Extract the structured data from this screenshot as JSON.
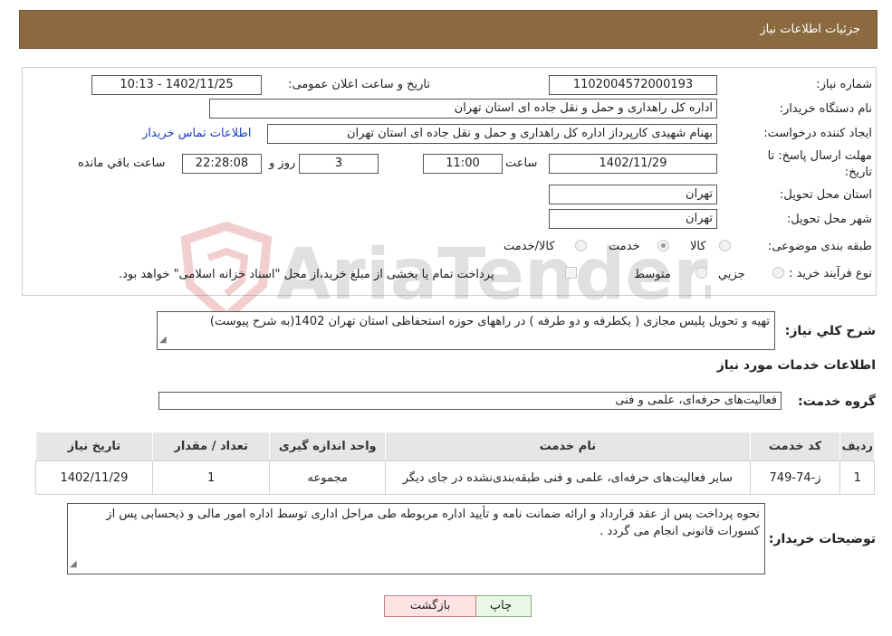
{
  "header": {
    "title": "جزئیات اطلاعات نیاز"
  },
  "form": {
    "need_number": {
      "label": "شماره نیاز:",
      "value": "1102004572000193"
    },
    "announce_datetime": {
      "label": "تاریخ و ساعت اعلان عمومی:",
      "value": "1402/11/25 - 10:13"
    },
    "buyer_org": {
      "label": "نام دستگاه خریدار:",
      "value": "اداره کل راهداری و حمل و نقل جاده ای استان تهران"
    },
    "requester": {
      "label": "ایجاد کننده درخواست:",
      "value": "بهنام شهیدی کارپرداز اداره کل راهداری و حمل و نقل جاده ای استان تهران",
      "contact_link": "اطلاعات تماس خریدار"
    },
    "deadline": {
      "label": "مهلت ارسال پاسخ: تا تاریخ:",
      "date": "1402/11/29",
      "time_label": "ساعت",
      "time": "11:00",
      "days": "3",
      "days_label": "روز و",
      "remaining": "22:28:08",
      "remaining_label": "ساعت باقي مانده"
    },
    "delivery_province": {
      "label": "استان محل تحویل:",
      "value": "تهران"
    },
    "delivery_city": {
      "label": "شهر محل تحویل:",
      "value": "تهران"
    },
    "category": {
      "label": "طبقه بندی موضوعی:",
      "options": [
        {
          "label": "کالا",
          "checked": false
        },
        {
          "label": "خدمت",
          "checked": true
        },
        {
          "label": "کالا/خدمت",
          "checked": false
        }
      ]
    },
    "purchase_process": {
      "label": "نوع فرآیند خرید :",
      "options": [
        {
          "label": "جزيي",
          "checked": false
        },
        {
          "label": "متوسط",
          "checked": false
        }
      ],
      "payment_note": "پرداخت تمام یا بخشی از مبلغ خرید،از محل \"اسناد خزانه اسلامی\" خواهد بود."
    }
  },
  "summary": {
    "label": "شرح کلي نياز:",
    "value": "تهیه و تحویل پلیس مجازی ( یکطرفه و دو طرفه ) در راههای حوزه استحفاظی استان تهران 1402(به شرح پیوست)"
  },
  "services_info": {
    "title": "اطلاعات خدمات مورد نياز",
    "group_label": "گروه خدمت:",
    "group_value": "فعالیت‌های حرفه‌ای، علمی و فنی"
  },
  "table": {
    "headers": [
      "رديف",
      "کد خدمت",
      "نام خدمت",
      "واحد اندازه گیری",
      "تعداد / مقدار",
      "تاریخ نیاز"
    ],
    "rows": [
      [
        "1",
        "ز-74-749",
        "سایر فعالیت‌های حرفه‌ای، علمی و فنی طبقه‌بندی‌نشده در جای دیگر",
        "مجموعه",
        "1",
        "1402/11/29"
      ]
    ]
  },
  "buyer_notes": {
    "label": "توضیحات خریدار:",
    "value": "نحوه پرداخت پس از عقد قرارداد و ارائه ضمانت نامه و تأیید اداره مربوطه طی مراحل اداری توسط اداره امور مالی و ذیحسابی پس از کسورات قانونی انجام می گردد ."
  },
  "buttons": {
    "print": "چاپ",
    "back": "بازگشت"
  },
  "watermark": {
    "text": "AriaTender.neT"
  }
}
